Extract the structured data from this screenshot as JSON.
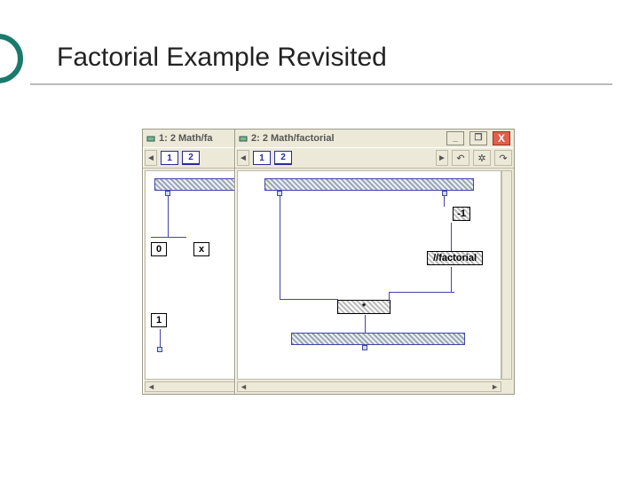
{
  "slide": {
    "title": "Factorial Example Revisited"
  },
  "windows": {
    "back": {
      "title": "1: 2 Math/fa",
      "tabs": [
        "1",
        "2"
      ],
      "nodes": {
        "zero": "0",
        "mult": "x",
        "one": "1"
      }
    },
    "front": {
      "title": "2: 2 Math/factorial",
      "tabs": [
        "1",
        "2"
      ],
      "controls": {
        "minimize": "_",
        "maximize": "❐",
        "close": "X"
      },
      "tools": {
        "undo": "↶",
        "grid": "✲",
        "redo": "↷"
      },
      "nodes": {
        "minus1": "-1",
        "factorial": "//factorial",
        "mult": "*"
      },
      "scroll": {
        "left": "◄",
        "right": "►",
        "up": "▲",
        "down": "▼"
      }
    }
  }
}
